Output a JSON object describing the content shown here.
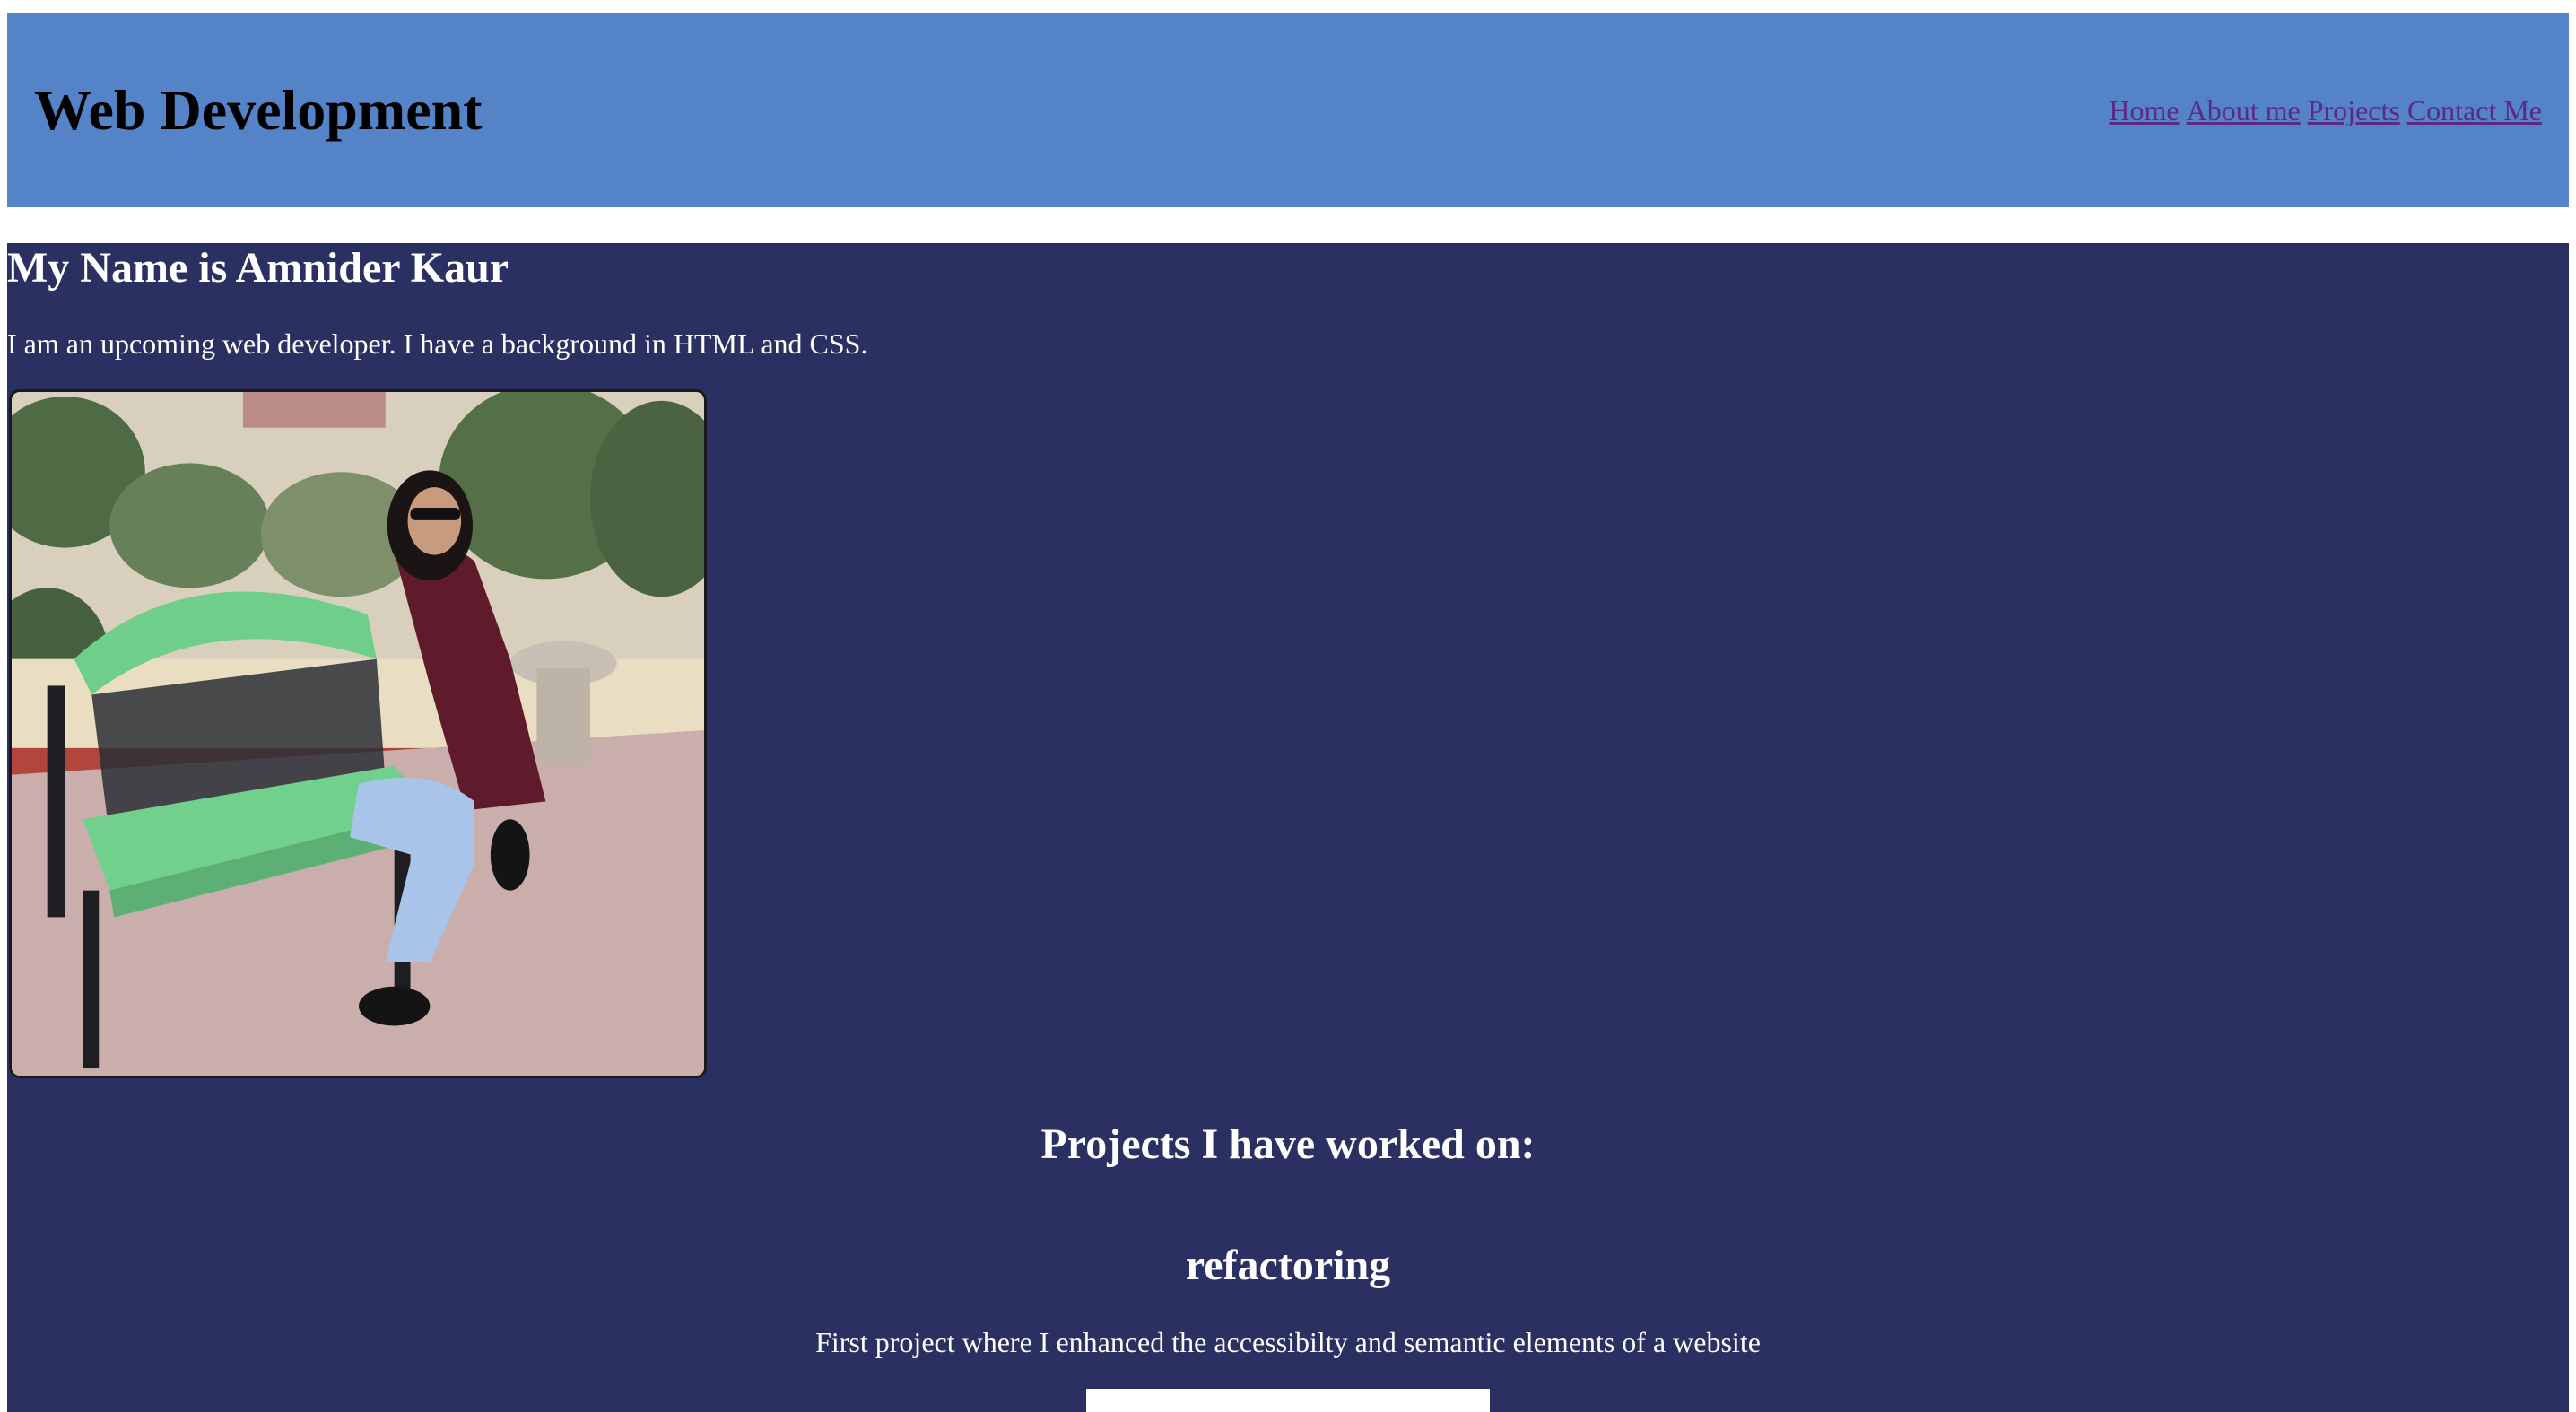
{
  "header": {
    "title": "Web Development",
    "nav": [
      {
        "label": "Home"
      },
      {
        "label": "About me"
      },
      {
        "label": "Projects"
      },
      {
        "label": "Contact Me"
      }
    ]
  },
  "about": {
    "heading": "My Name is Amnider Kaur",
    "text": "I am an upcoming web developer. I have a background in HTML and CSS."
  },
  "projects": {
    "heading": "Projects I have worked on:",
    "items": [
      {
        "title": "refactoring",
        "description": "First project where I enhanced the accessibilty and semantic elements of a website"
      }
    ]
  },
  "colors": {
    "header_bg": "#5583c7",
    "main_bg": "#2b3062",
    "link": "#5b2a86"
  }
}
